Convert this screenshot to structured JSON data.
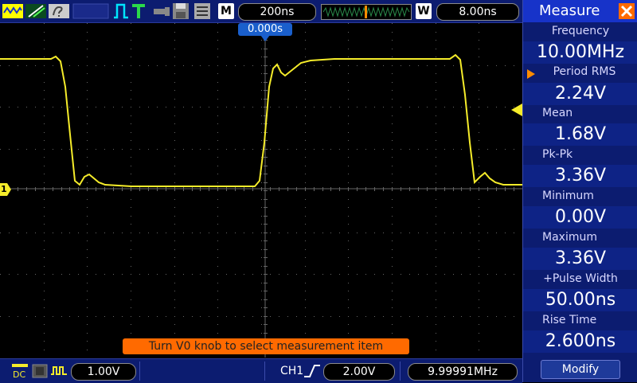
{
  "toolbar": {
    "icons": [
      "run-mode-icon",
      "probe-icon",
      "help-icon",
      "blank-indicator",
      "trigger-pulse-icon",
      "trigger-T-icon",
      "usb-icon",
      "save-icon",
      "menu-icon"
    ],
    "m_label": "M",
    "timebase": "200ns",
    "w_label": "W",
    "window": "8.00ns"
  },
  "trigger_position": "0.000s",
  "ch1_marker": "1",
  "message": "Turn V0 knob to select measurement item",
  "bottom": {
    "ch_scale": "1.00V",
    "ch_label": "CH1",
    "trigger_level": "2.00V",
    "frequency": "9.99991MHz"
  },
  "measure_panel": {
    "title": "Measure",
    "items": [
      {
        "label": "Frequency",
        "value": "10.00MHz"
      },
      {
        "label": "Period RMS",
        "value": "2.24V"
      },
      {
        "label": "Mean",
        "value": "1.68V"
      },
      {
        "label": "Pk-Pk",
        "value": "3.36V"
      },
      {
        "label": "Minimum",
        "value": "0.00V"
      },
      {
        "label": "Maximum",
        "value": "3.36V"
      },
      {
        "label": "+Pulse Width",
        "value": "50.00ns"
      },
      {
        "label": "Rise Time",
        "value": "2.600ns"
      }
    ],
    "modify_label": "Modify"
  },
  "colors": {
    "trace": "#f5ec2a",
    "panel_bg": "#0c1c70",
    "title_bg": "#1733c9",
    "message_bg": "#ff6a00",
    "accent_orange": "#ff8c00",
    "grid": "#666666"
  }
}
